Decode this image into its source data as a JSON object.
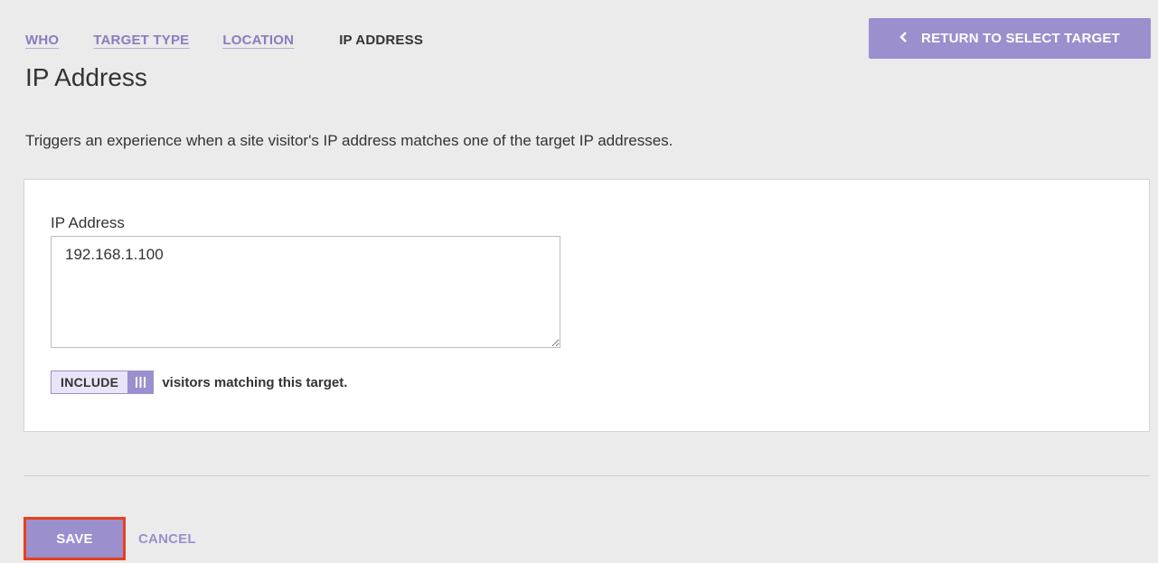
{
  "breadcrumb": {
    "items": [
      {
        "label": "WHO"
      },
      {
        "label": "TARGET TYPE"
      },
      {
        "label": "LOCATION"
      },
      {
        "label": "IP ADDRESS"
      }
    ]
  },
  "header": {
    "return_button_label": "RETURN TO SELECT TARGET",
    "return_icon": "chevron-left-icon",
    "title": "IP Address"
  },
  "description": "Triggers an experience when a site visitor's IP address matches one of the target IP addresses.",
  "form": {
    "ip_label": "IP Address",
    "ip_value": "192.168.1.100",
    "toggle": {
      "label": "INCLUDE",
      "handle_icon": "grip-icon",
      "suffix": "visitors matching this target."
    }
  },
  "footer": {
    "save_label": "SAVE",
    "cancel_label": "CANCEL"
  },
  "colors": {
    "accent": "#9b8fce",
    "highlight": "#e8401c",
    "background": "#ebebeb"
  }
}
